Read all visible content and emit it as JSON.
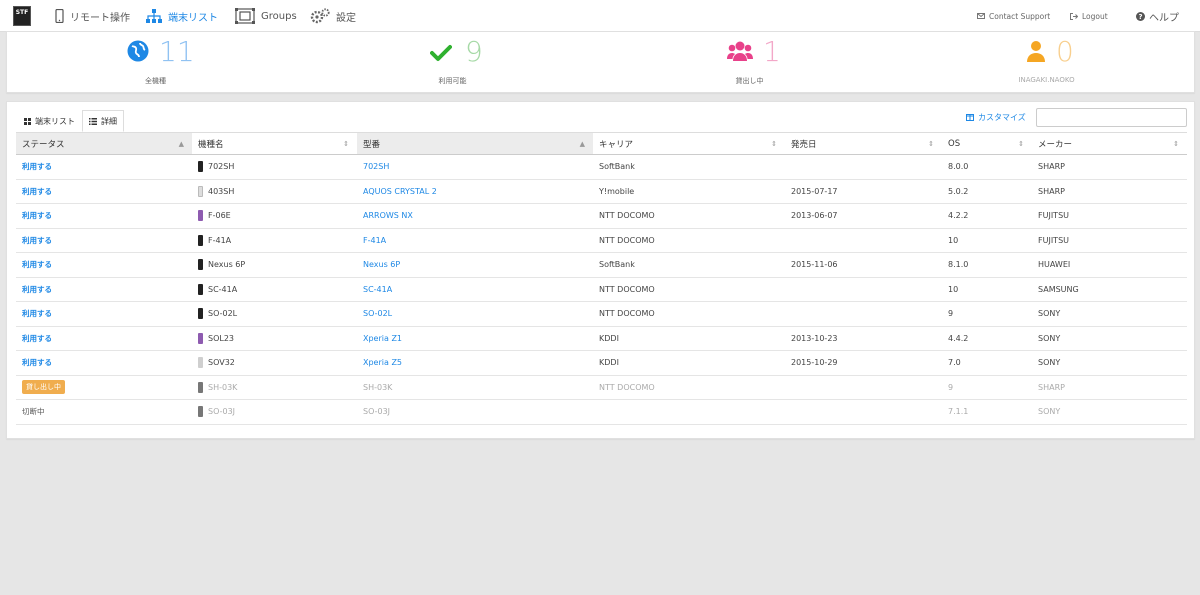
{
  "nav": {
    "logo": "STF",
    "items": [
      {
        "label": "リモート操作",
        "icon": "phone-icon"
      },
      {
        "label": "端末リスト",
        "icon": "sitemap-icon"
      },
      {
        "label": "Groups",
        "icon": "groups-icon"
      },
      {
        "label": "設定",
        "icon": "gears-icon"
      }
    ],
    "contact": "Contact Support",
    "logout": "Logout",
    "help": "ヘルプ"
  },
  "stats": [
    {
      "value": "11",
      "label": "全機種",
      "color": "#1e88e5",
      "icon": "globe-icon"
    },
    {
      "value": "9",
      "label": "利用可能",
      "color": "#4caf50",
      "icon": "check-icon"
    },
    {
      "value": "1",
      "label": "貸出し中",
      "color": "#e8418a",
      "icon": "users-icon"
    },
    {
      "value": "0",
      "label": "INAGAKI.NAOKO",
      "color": "#f5a623",
      "icon": "user-icon"
    }
  ],
  "tabs": [
    {
      "label": "端末リスト",
      "icon": "grid-icon"
    },
    {
      "label": "詳細",
      "icon": "list-icon"
    }
  ],
  "customize": "カスタマイズ",
  "columns": [
    "ステータス",
    "機種名",
    "型番",
    "キャリア",
    "発売日",
    "OS",
    "メーカー"
  ],
  "rows": [
    {
      "status": "利用する",
      "name": "702SH",
      "model": "702SH",
      "carrier": "SoftBank",
      "release": "",
      "os": "8.0.0",
      "maker": "SHARP"
    },
    {
      "status": "利用する",
      "name": "403SH",
      "model": "AQUOS CRYSTAL 2",
      "carrier": "Y!mobile",
      "release": "2015-07-17",
      "os": "5.0.2",
      "maker": "SHARP"
    },
    {
      "status": "利用する",
      "name": "F-06E",
      "model": "ARROWS NX",
      "carrier": "NTT DOCOMO",
      "release": "2013-06-07",
      "os": "4.2.2",
      "maker": "FUJITSU"
    },
    {
      "status": "利用する",
      "name": "F-41A",
      "model": "F-41A",
      "carrier": "NTT DOCOMO",
      "release": "",
      "os": "10",
      "maker": "FUJITSU"
    },
    {
      "status": "利用する",
      "name": "Nexus 6P",
      "model": "Nexus 6P",
      "carrier": "SoftBank",
      "release": "2015-11-06",
      "os": "8.1.0",
      "maker": "HUAWEI"
    },
    {
      "status": "利用する",
      "name": "SC-41A",
      "model": "SC-41A",
      "carrier": "NTT DOCOMO",
      "release": "",
      "os": "10",
      "maker": "SAMSUNG"
    },
    {
      "status": "利用する",
      "name": "SO-02L",
      "model": "SO-02L",
      "carrier": "NTT DOCOMO",
      "release": "",
      "os": "9",
      "maker": "SONY"
    },
    {
      "status": "利用する",
      "name": "SOL23",
      "model": "Xperia Z1",
      "carrier": "KDDI",
      "release": "2013-10-23",
      "os": "4.4.2",
      "maker": "SONY"
    },
    {
      "status": "利用する",
      "name": "SOV32",
      "model": "Xperia Z5",
      "carrier": "KDDI",
      "release": "2015-10-29",
      "os": "7.0",
      "maker": "SONY"
    },
    {
      "status": "貸し出し中",
      "name": "SH-03K",
      "model": "SH-03K",
      "carrier": "NTT DOCOMO",
      "release": "",
      "os": "9",
      "maker": "SHARP"
    },
    {
      "status": "切断中",
      "name": "SO-03J",
      "model": "SO-03J",
      "carrier": "",
      "release": "",
      "os": "7.1.1",
      "maker": "SONY"
    }
  ]
}
